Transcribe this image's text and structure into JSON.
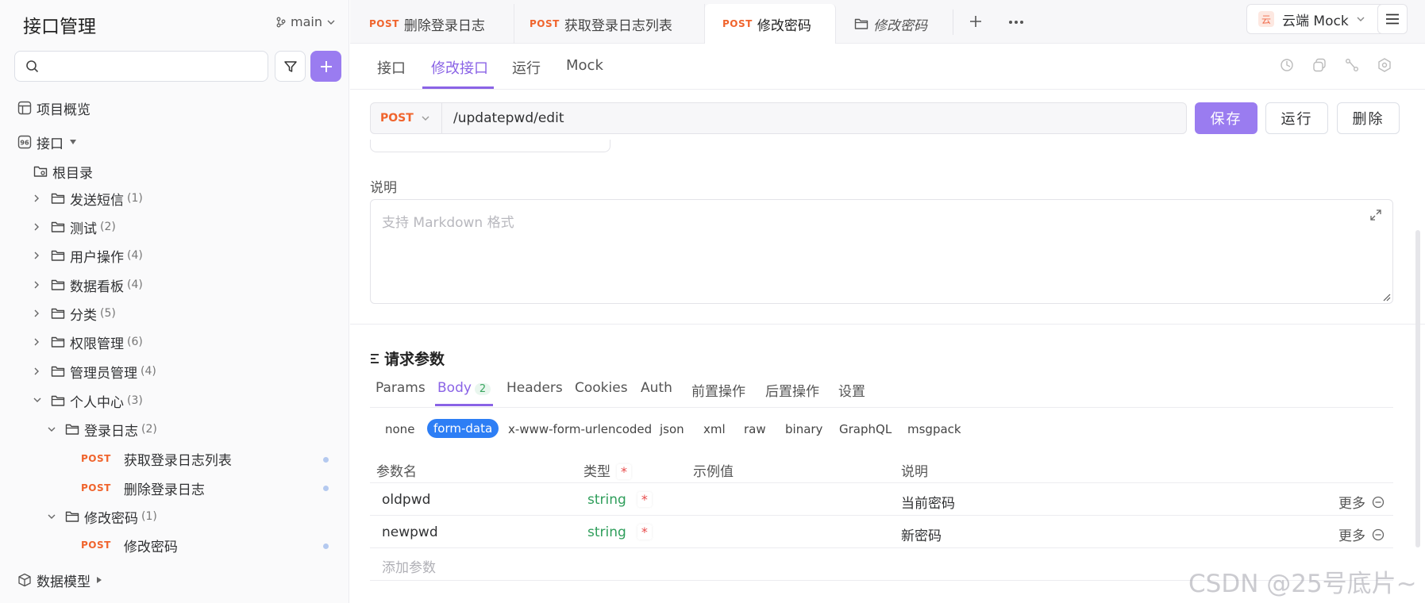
{
  "sidebar": {
    "title": "接口管理",
    "branch": "main",
    "tree": {
      "overview": "项目概览",
      "interfaces": "接口",
      "root": "根目录",
      "folders": [
        {
          "label": "发送短信",
          "count": "(1)"
        },
        {
          "label": "测试",
          "count": "(2)"
        },
        {
          "label": "用户操作",
          "count": "(4)"
        },
        {
          "label": "数据看板",
          "count": "(4)"
        },
        {
          "label": "分类",
          "count": "(5)"
        },
        {
          "label": "权限管理",
          "count": "(6)"
        },
        {
          "label": "管理员管理",
          "count": "(4)"
        },
        {
          "label": "个人中心",
          "count": "(3)"
        }
      ],
      "login_log": {
        "label": "登录日志",
        "count": "(2)"
      },
      "login_items": [
        {
          "method": "POST",
          "label": "获取登录日志列表"
        },
        {
          "method": "POST",
          "label": "删除登录日志"
        }
      ],
      "change_pwd": {
        "label": "修改密码",
        "count": "(1)"
      },
      "change_pwd_item": {
        "method": "POST",
        "label": "修改密码"
      },
      "data_model": "数据模型"
    }
  },
  "tabs": [
    {
      "method": "POST",
      "label": "删除登录日志"
    },
    {
      "method": "POST",
      "label": "获取登录日志列表"
    },
    {
      "method": "POST",
      "label": "修改密码"
    },
    {
      "method": "",
      "label": "修改密码"
    }
  ],
  "env": {
    "label": "云端 Mock",
    "icon_text": "云"
  },
  "subtabs": [
    "接口",
    "修改接口",
    "运行",
    "Mock"
  ],
  "url": {
    "method": "POST",
    "path": "/updatepwd/edit"
  },
  "buttons": {
    "save": "保存",
    "run": "运行",
    "delete": "删除"
  },
  "description": {
    "label": "说明",
    "placeholder": "支持 Markdown 格式"
  },
  "params": {
    "title": "请求参数",
    "tabs": [
      "Params",
      "Body",
      "Headers",
      "Cookies",
      "Auth",
      "前置操作",
      "后置操作",
      "设置"
    ],
    "body_count": "2",
    "body_types": [
      "none",
      "form-data",
      "x-www-form-urlencoded",
      "json",
      "xml",
      "raw",
      "binary",
      "GraphQL",
      "msgpack"
    ],
    "columns": {
      "name": "参数名",
      "type": "类型",
      "example": "示例值",
      "desc": "说明",
      "required_mark": "*"
    },
    "rows": [
      {
        "name": "oldpwd",
        "type": "string",
        "required": "*",
        "desc": "当前密码",
        "more": "更多"
      },
      {
        "name": "newpwd",
        "type": "string",
        "required": "*",
        "desc": "新密码",
        "more": "更多"
      }
    ],
    "add_label": "添加参数"
  },
  "watermark": "CSDN @25号底片~",
  "colors": {
    "accent": "#8a63e6",
    "primary_button": "#9a7cf0",
    "post": "#f0642d",
    "string_type": "#2f9e5b",
    "selected_body": "#2d7ef5"
  }
}
